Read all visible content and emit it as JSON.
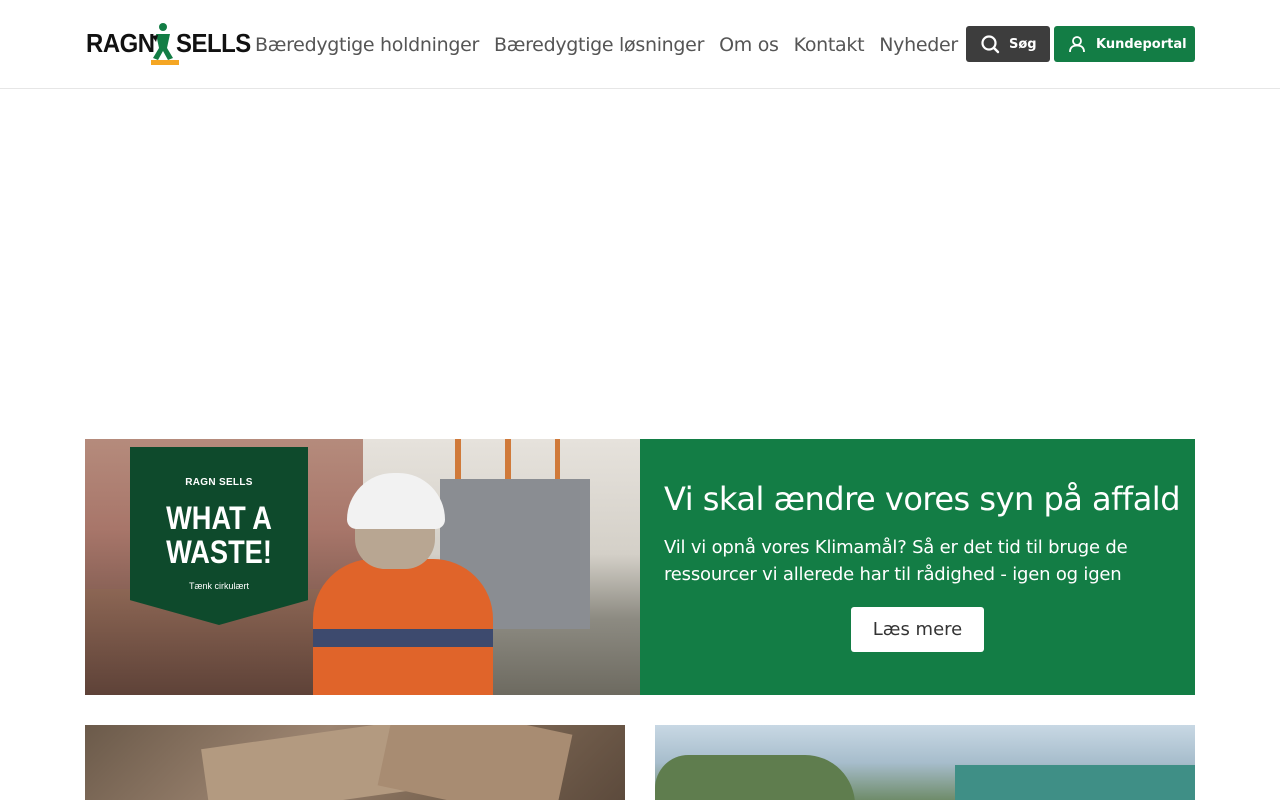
{
  "header": {
    "logo": {
      "left": "RAGN",
      "right": "SELLS"
    },
    "nav": [
      {
        "label": "Bæredygtige holdninger"
      },
      {
        "label": "Bæredygtige løsninger"
      },
      {
        "label": "Om os"
      },
      {
        "label": "Kontakt"
      },
      {
        "label": "Nyheder"
      }
    ],
    "search_label": "Søg",
    "portal_label": "Kundeportal"
  },
  "promo": {
    "title": "Vi skal ændre vores syn på affald",
    "subtitle": "Vil vi opnå vores Klimamål? Så er det tid til bruge de ressourcer vi allerede har til rådighed - igen og igen",
    "button_label": "Læs mere",
    "image": {
      "banner_logo": "RAGN SELLS",
      "banner_title": "WHAT A WASTE!",
      "banner_sub": "Tænk cirkulært"
    }
  },
  "colors": {
    "brand_green": "#137d45",
    "dark_button": "#3d3d3d",
    "logo_accent": "#f5a623"
  }
}
